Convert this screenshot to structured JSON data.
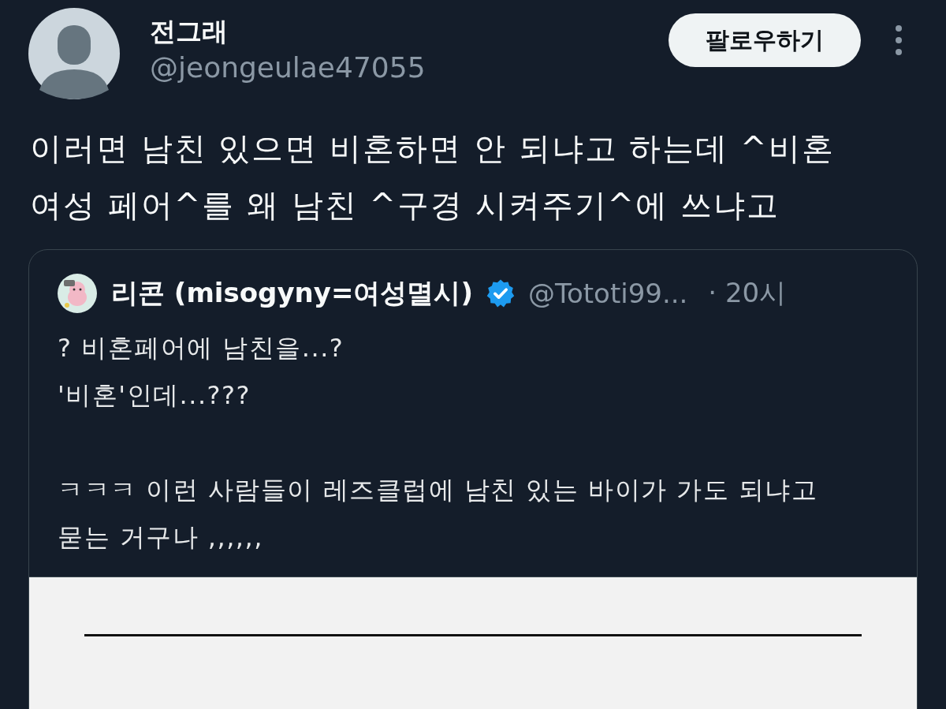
{
  "author": {
    "name": "전그래",
    "handle": "@jeongeulae47055"
  },
  "follow_button": "팔로우하기",
  "tweet_text": [
    "이러면 남친 있으면 비혼하면 안 되냐고 하는데 ^비혼 여성 페어^를 왜 남친 ^구경 시켜주기^에 쓰냐고"
  ],
  "quoted_tweet": {
    "author_name": "리콘 (misogyny=여성멸시)",
    "verified": true,
    "handle": "@Tototi99...",
    "time": "· 20시",
    "paragraphs": [
      "? 비혼페어에 남친을...?\n'비혼'인데...???",
      "ㅋㅋㅋ 이런 사람들이 레즈클럽에 남친 있는 바이가 가도 되냐고 묻는 거구나 ,,,,,,"
    ],
    "media": {
      "kind": "document"
    }
  }
}
